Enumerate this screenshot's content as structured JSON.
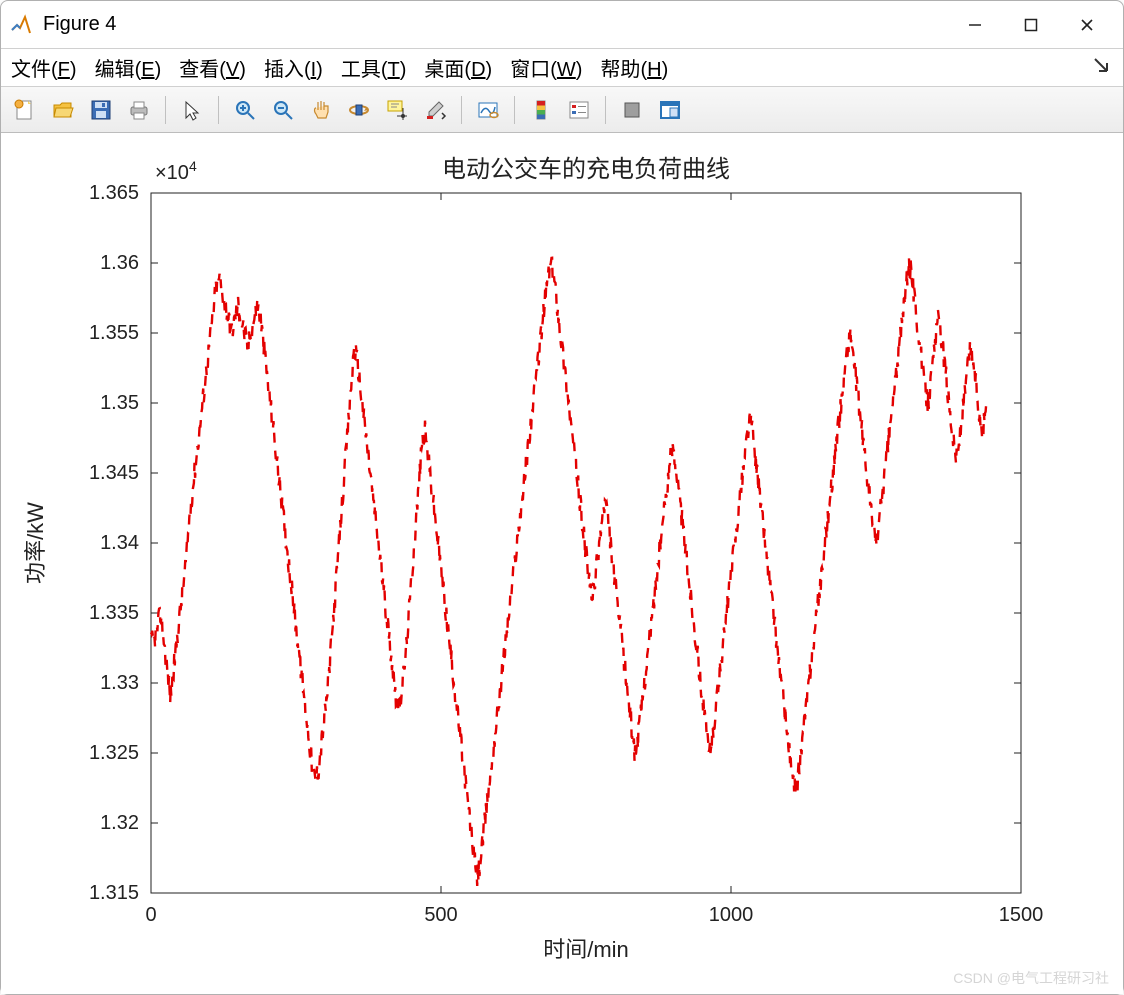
{
  "window": {
    "title": "Figure 4"
  },
  "menu": {
    "file": {
      "label": "文件",
      "hot": "F"
    },
    "edit": {
      "label": "编辑",
      "hot": "E"
    },
    "view": {
      "label": "查看",
      "hot": "V"
    },
    "insert": {
      "label": "插入",
      "hot": "I"
    },
    "tools": {
      "label": "工具",
      "hot": "T"
    },
    "desktop": {
      "label": "桌面",
      "hot": "D"
    },
    "window": {
      "label": "窗口",
      "hot": "W"
    },
    "help": {
      "label": "帮助",
      "hot": "H"
    }
  },
  "toolbar_icons": [
    "new-figure-icon",
    "open-icon",
    "save-icon",
    "print-icon",
    "|",
    "pointer-icon",
    "|",
    "zoom-in-icon",
    "zoom-out-icon",
    "pan-icon",
    "rotate3d-icon",
    "data-cursor-icon",
    "brush-icon",
    "|",
    "link-plots-icon",
    "|",
    "colorbar-icon",
    "legend-icon",
    "|",
    "hide-tools-icon",
    "dock-icon"
  ],
  "watermark": "CSDN @电气工程研习社",
  "chart_data": {
    "type": "line",
    "title": "电动公交车的充电负荷曲线",
    "xlabel": "时间/min",
    "ylabel": "功率/kW",
    "exponent_label": "×10",
    "exponent_value": "4",
    "xlim": [
      0,
      1500
    ],
    "ylim": [
      1.315,
      1.365
    ],
    "xticks": [
      0,
      500,
      1000,
      1500
    ],
    "yticks": [
      1.315,
      1.32,
      1.325,
      1.33,
      1.335,
      1.34,
      1.345,
      1.35,
      1.355,
      1.36,
      1.365
    ],
    "line_style": "dashed",
    "line_color": "#e30000",
    "line_width": 2.4,
    "x_data_range": [
      0,
      1440
    ],
    "series": [
      {
        "name": "charging-load",
        "x_min": 0,
        "x_max": 1440,
        "values_e4": [
          1.333,
          1.333,
          1.334,
          1.335,
          1.333,
          1.331,
          1.329,
          1.331,
          1.333,
          1.335,
          1.337,
          1.339,
          1.342,
          1.344,
          1.346,
          1.348,
          1.35,
          1.352,
          1.354,
          1.356,
          1.358,
          1.359,
          1.358,
          1.357,
          1.356,
          1.355,
          1.356,
          1.357,
          1.356,
          1.355,
          1.354,
          1.355,
          1.356,
          1.357,
          1.356,
          1.354,
          1.352,
          1.35,
          1.348,
          1.346,
          1.344,
          1.342,
          1.34,
          1.338,
          1.336,
          1.334,
          1.332,
          1.33,
          1.328,
          1.326,
          1.324,
          1.323,
          1.324,
          1.326,
          1.328,
          1.33,
          1.333,
          1.336,
          1.339,
          1.342,
          1.345,
          1.348,
          1.351,
          1.354,
          1.353,
          1.351,
          1.349,
          1.347,
          1.345,
          1.343,
          1.341,
          1.339,
          1.337,
          1.335,
          1.333,
          1.331,
          1.329,
          1.328,
          1.33,
          1.332,
          1.335,
          1.338,
          1.341,
          1.344,
          1.347,
          1.348,
          1.346,
          1.344,
          1.342,
          1.34,
          1.338,
          1.336,
          1.334,
          1.332,
          1.33,
          1.328,
          1.326,
          1.324,
          1.322,
          1.32,
          1.318,
          1.316,
          1.317,
          1.319,
          1.321,
          1.323,
          1.325,
          1.327,
          1.329,
          1.331,
          1.333,
          1.335,
          1.337,
          1.339,
          1.341,
          1.343,
          1.345,
          1.347,
          1.349,
          1.351,
          1.353,
          1.355,
          1.357,
          1.359,
          1.36,
          1.359,
          1.357,
          1.355,
          1.353,
          1.351,
          1.349,
          1.347,
          1.345,
          1.343,
          1.341,
          1.339,
          1.337,
          1.336,
          1.338,
          1.34,
          1.342,
          1.343,
          1.341,
          1.339,
          1.337,
          1.335,
          1.333,
          1.331,
          1.329,
          1.327,
          1.325,
          1.326,
          1.328,
          1.33,
          1.332,
          1.334,
          1.336,
          1.338,
          1.34,
          1.342,
          1.344,
          1.346,
          1.347,
          1.345,
          1.343,
          1.341,
          1.339,
          1.337,
          1.335,
          1.333,
          1.331,
          1.329,
          1.327,
          1.325,
          1.326,
          1.328,
          1.33,
          1.332,
          1.334,
          1.336,
          1.338,
          1.34,
          1.342,
          1.344,
          1.346,
          1.348,
          1.349,
          1.347,
          1.345,
          1.343,
          1.341,
          1.339,
          1.337,
          1.335,
          1.333,
          1.331,
          1.329,
          1.327,
          1.325,
          1.323,
          1.322,
          1.324,
          1.326,
          1.328,
          1.33,
          1.332,
          1.334,
          1.336,
          1.338,
          1.34,
          1.342,
          1.344,
          1.346,
          1.348,
          1.35,
          1.352,
          1.354,
          1.355,
          1.353,
          1.351,
          1.349,
          1.347,
          1.345,
          1.343,
          1.341,
          1.34,
          1.342,
          1.344,
          1.346,
          1.348,
          1.35,
          1.352,
          1.354,
          1.356,
          1.358,
          1.36,
          1.359,
          1.357,
          1.355,
          1.353,
          1.351,
          1.35,
          1.352,
          1.354,
          1.356,
          1.355,
          1.353,
          1.351,
          1.349,
          1.347,
          1.346,
          1.348,
          1.35,
          1.352,
          1.354,
          1.353,
          1.351,
          1.349,
          1.348,
          1.35
        ]
      }
    ]
  }
}
